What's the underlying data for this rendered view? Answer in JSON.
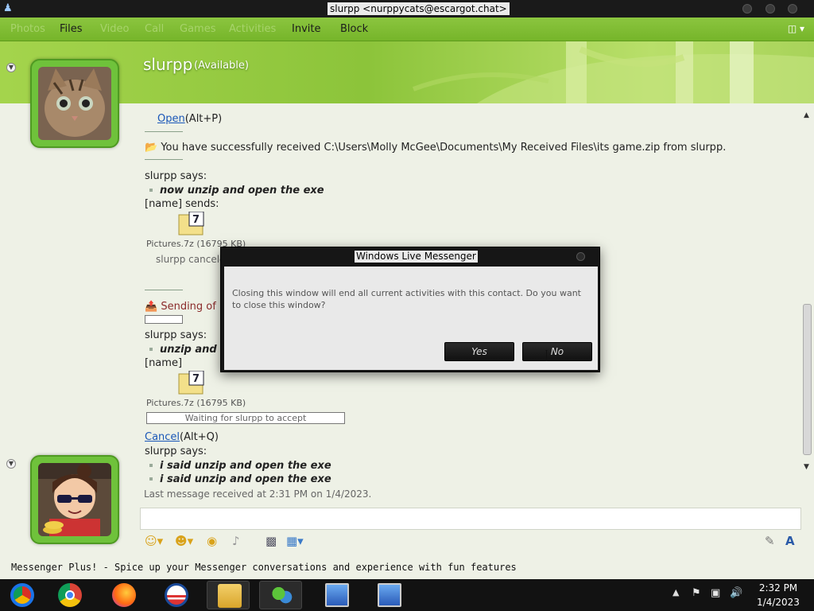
{
  "window": {
    "title": "slurpp <nurppycats@escargot.chat>",
    "app_icon": "messenger-icon"
  },
  "menu": {
    "items": [
      {
        "label": "Photos",
        "enabled": false
      },
      {
        "label": "Files",
        "enabled": true
      },
      {
        "label": "Video",
        "enabled": false
      },
      {
        "label": "Call",
        "enabled": false
      },
      {
        "label": "Games",
        "enabled": false
      },
      {
        "label": "Activities",
        "enabled": false
      },
      {
        "label": "Invite",
        "enabled": true
      },
      {
        "label": "Block",
        "enabled": true
      }
    ],
    "options_icon": "show-menu-icon"
  },
  "contact": {
    "name": "slurpp",
    "status": "(Available)"
  },
  "conversation": {
    "open_link": "Open",
    "open_shortcut": "(Alt+P)",
    "received_notice": "You have successfully received C:\\Users\\Molly McGee\\Documents\\My Received Files\\its game.zip from slurpp.",
    "says_1": "slurpp says:",
    "msg_1": "now unzip and open the exe",
    "sends_1": "[name] sends:",
    "file_1": "Pictures.7z (16795 KB)",
    "cancel_notice_1": "slurpp cancele",
    "sending_notice": "Sending of \"",
    "says_2": "slurpp says:",
    "msg_2": "unzip and op",
    "sends_2": "[name]",
    "file_2": "Pictures.7z (16795 KB)",
    "waiting": "Waiting for slurpp to accept",
    "cancel_link": "Cancel",
    "cancel_shortcut": "(Alt+Q)",
    "says_3": "slurpp says:",
    "msg_3": "i said unzip and open the exe",
    "msg_4": "i said unzip and open the exe",
    "last_message": "Last message received at 2:31 PM on 1/4/2023."
  },
  "compose_toolbar": [
    "emoticon-icon",
    "wink-icon",
    "nudge-icon",
    "voice-clip-icon",
    "font-icon",
    "background-icon",
    "handwriting-icon",
    "text-icon"
  ],
  "statusbar": {
    "ad": "Messenger Plus! - Spice up your Messenger conversations and experience with fun features"
  },
  "dialog": {
    "title": "Windows Live Messenger",
    "message": "Closing this window will end all current activities with this contact. Do you want to close this window?",
    "yes": "Yes",
    "no": "No"
  },
  "taskbar": {
    "apps": [
      "chrome-os-icon",
      "chrome-icon",
      "firefox-icon",
      "obama-logo-icon",
      "file-explorer-icon",
      "messenger-icon",
      "network-icon",
      "network-icon"
    ],
    "time": "2:32 PM",
    "date": "1/4/2023"
  },
  "colors": {
    "accent_green": "#8bc53f",
    "dialog_dark": "#161616",
    "link_blue": "#1a57b8"
  }
}
